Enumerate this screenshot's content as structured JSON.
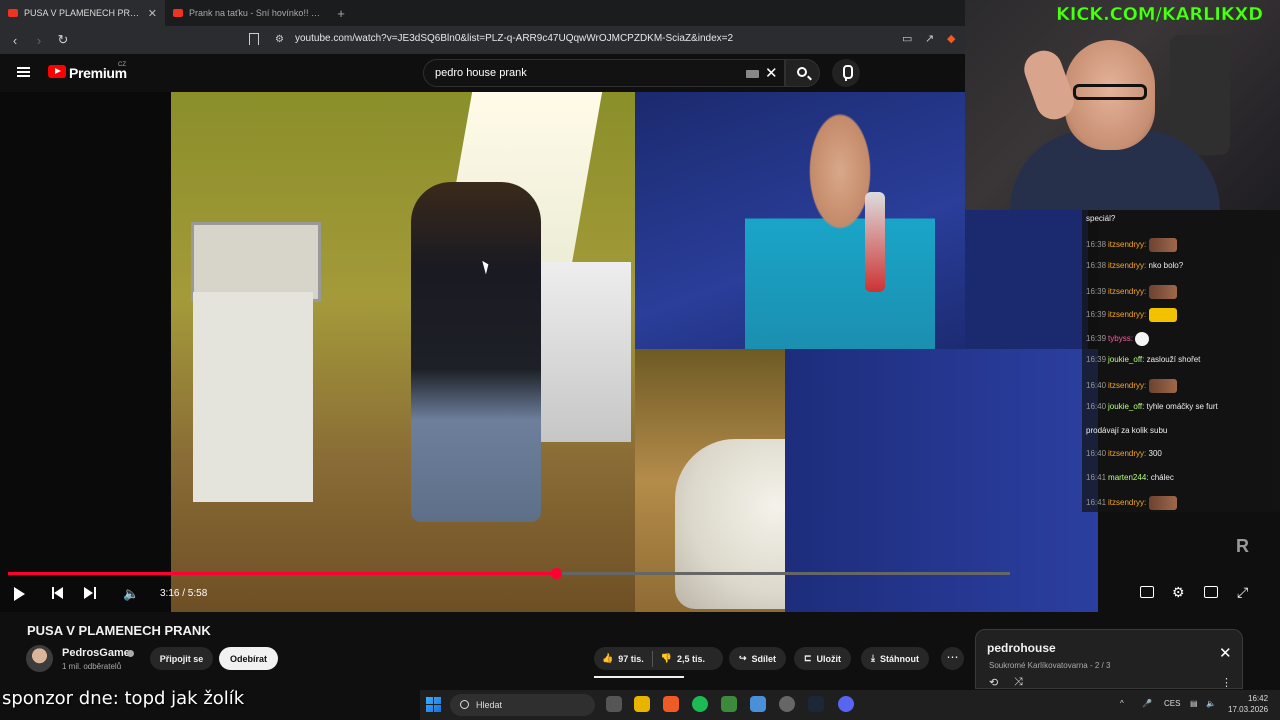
{
  "browser": {
    "tabs": [
      {
        "label": "PUSA V PLAMENECH PRANK",
        "active": true
      },
      {
        "label": "Prank na taťku - Sní hovínko!! - YouT",
        "active": false
      }
    ],
    "url": "youtube.com/watch?v=JE3dSQ6Bln0&list=PLZ-q-ARR9c47UQqwWrOJMCPZDKM-SciaZ&index=2"
  },
  "youtube": {
    "brand": "Premium",
    "country": "CZ",
    "search_query": "pedro house prank"
  },
  "player": {
    "current_time": "3:16",
    "duration": "5:58",
    "timecode": "3:16 / 5:58",
    "progress": 0.547
  },
  "video": {
    "title": "PUSA V PLAMENECH PRANK",
    "channel": "PedrosGame",
    "subscribers": "1 mil. odběratelů",
    "join_label": "Připojit se",
    "subscribe_label": "Odebírat",
    "likes": "97 tis.",
    "dislikes": "2,5 tis.",
    "share_label": "Sdílet",
    "save_label": "Uložit",
    "download_label": "Stáhnout"
  },
  "playlist": {
    "title": "pedrohouse",
    "meta": "Soukromé Karlíkovatovarna - 2 / 3"
  },
  "stream": {
    "kick_url": "KICK.COM/KARLIKXD",
    "sponsor": "sponzor dne: topd jak žolík"
  },
  "chat": [
    {
      "time": "",
      "user": "",
      "text": "speciál?"
    },
    {
      "time": "16:38",
      "user": "itzsendryy:",
      "text": "",
      "emote": "face"
    },
    {
      "time": "16:38",
      "user": "itzsendryy:",
      "text": "nko bolo?"
    },
    {
      "time": "16:39",
      "user": "itzsendryy:",
      "text": "",
      "emote": "face"
    },
    {
      "time": "16:39",
      "user": "itzsendryy:",
      "text": "",
      "emote": "yellow"
    },
    {
      "time": "16:39",
      "user": "tybyss:",
      "text": "",
      "emote": "white",
      "userColor": "p"
    },
    {
      "time": "16:39",
      "user": "joukie_off:",
      "text": "zaslouží shořet",
      "userColor": "g"
    },
    {
      "time": "16:40",
      "user": "itzsendryy:",
      "text": "",
      "emote": "face"
    },
    {
      "time": "16:40",
      "user": "joukie_off:",
      "text": "tyhle omáčky se furt",
      "userColor": "g"
    },
    {
      "time": "",
      "user": "",
      "text": "prodávají za kolik subu"
    },
    {
      "time": "16:40",
      "user": "itzsendryy:",
      "text": "300"
    },
    {
      "time": "16:41",
      "user": "marten244:",
      "text": "chálec",
      "userColor": "g"
    },
    {
      "time": "16:41",
      "user": "itzsendryy:",
      "text": "",
      "emote": "face"
    },
    {
      "time": "16:41",
      "user": "tybyss:",
      "text": "",
      "emote": "white",
      "userColor": "p"
    }
  ],
  "taskbar": {
    "search_placeholder": "Hledat",
    "language": "CES",
    "time": "16:42",
    "date": "17.03.2026"
  },
  "colors": {
    "accent": "#ff0033",
    "kick": "#53fc18",
    "background": "#0f0f0f"
  }
}
